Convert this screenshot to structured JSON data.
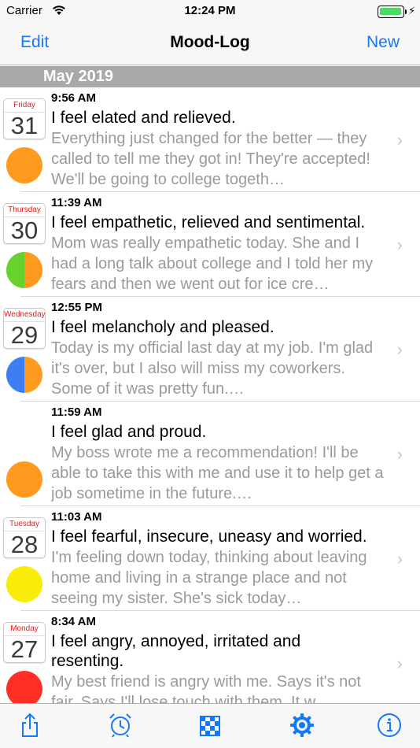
{
  "status_bar": {
    "carrier": "Carrier",
    "time": "12:24 PM",
    "wifi_icon": "wifi-icon",
    "battery_icon": "battery-icon"
  },
  "nav": {
    "left": "Edit",
    "title": "Mood-Log",
    "right": "New"
  },
  "section": {
    "title": "May 2019"
  },
  "entries": [
    {
      "weekday": "Friday",
      "date": "31",
      "time": "9:56 AM",
      "title": "I feel elated and relieved.",
      "detail": "Everything just changed for the better — they called to tell me they got in! They're accepted! We'll be going to college togeth…",
      "mood_colors": [
        "#ff9a1f"
      ]
    },
    {
      "weekday": "Thursday",
      "date": "30",
      "time": "11:39 AM",
      "title": "I feel empathetic, relieved and sentimental.",
      "detail": "Mom was really empathetic today. She and I had a long talk about college and I told her my fears and then we went out for ice cre…",
      "mood_colors": [
        "#66d22b",
        "#ff9a1f"
      ]
    },
    {
      "weekday": "Wednesday",
      "date": "29",
      "time": "12:55 PM",
      "title": "I feel melancholy and pleased.",
      "detail": "Today is my official last day at my job. I'm glad it's over, but I also will miss my coworkers. Some of it was pretty fun.…",
      "mood_colors": [
        "#3d7ff2",
        "#ff9a1f"
      ]
    },
    {
      "weekday": "",
      "date": "",
      "time": "11:59 AM",
      "title": "I feel glad and proud.",
      "detail": "My boss wrote me a recommendation! I'll be able to take this with me and use it to help get a job sometime in the future.…",
      "mood_colors": [
        "#ff9a1f"
      ]
    },
    {
      "weekday": "Tuesday",
      "date": "28",
      "time": "11:03 AM",
      "title": "I feel fearful, insecure, uneasy and worried.",
      "detail": "I'm feeling down today, thinking about leaving home and living in a strange place and not seeing my sister. She's sick today…",
      "mood_colors": [
        "#f9ec09"
      ]
    },
    {
      "weekday": "Monday",
      "date": "27",
      "time": "8:34 AM",
      "title": "I feel angry, annoyed, irritated and resenting.",
      "detail": "My best friend is angry with me. Says it's not fair. Says I'll lose touch with them. It w…",
      "mood_colors": [
        "#ff2f26"
      ]
    }
  ],
  "tab_bar": {
    "tint": "#1479f6",
    "items": [
      "share-icon",
      "alarm-clock-icon",
      "calendar-checker-icon",
      "settings-gear-icon",
      "info-icon"
    ]
  }
}
